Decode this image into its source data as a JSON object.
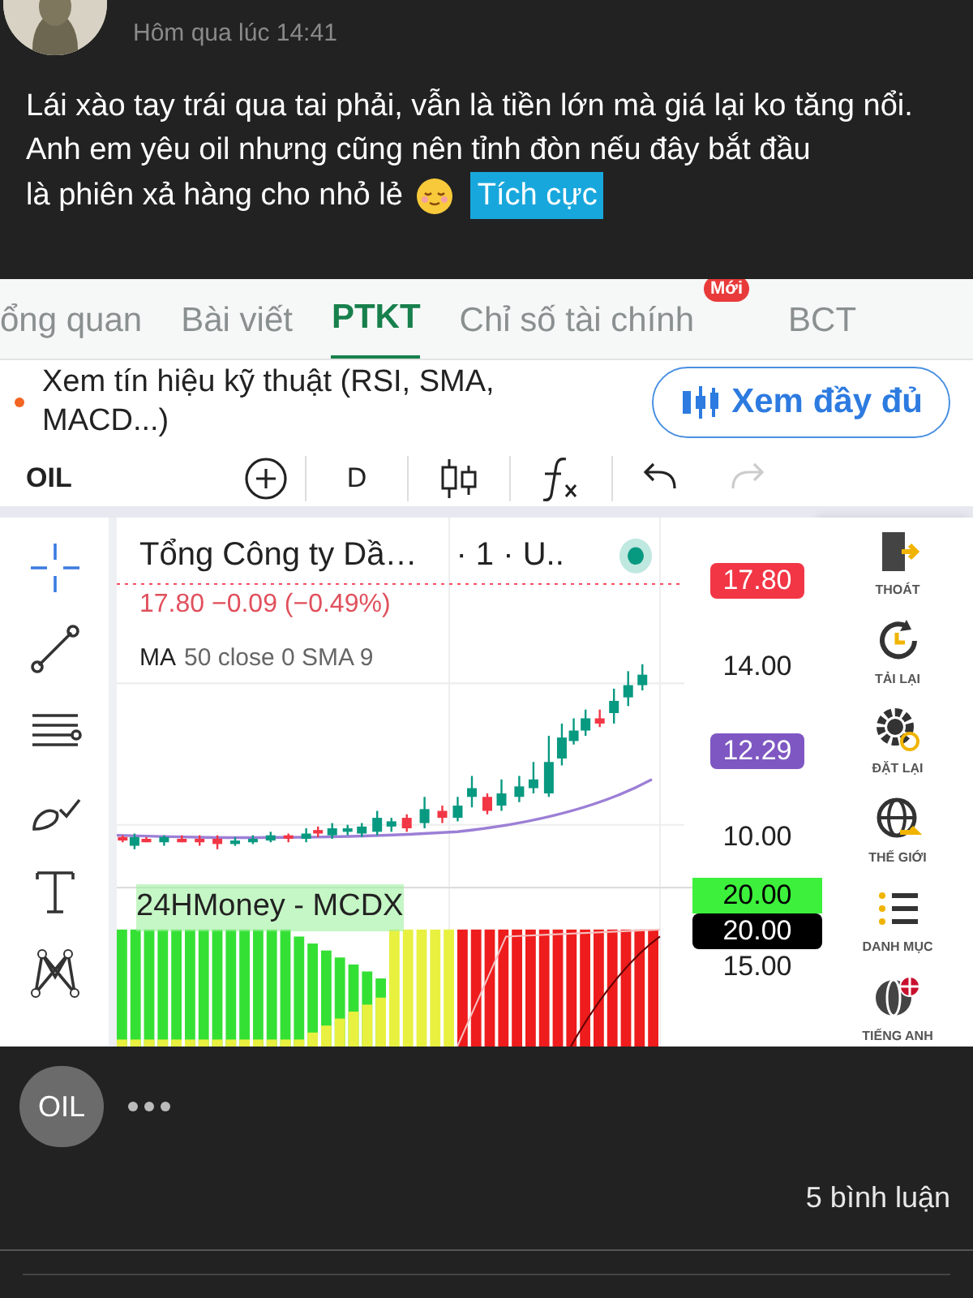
{
  "post": {
    "time": "Hôm qua lúc 14:41",
    "text_lines": [
      "Lái xào tay trái qua tai phải, vẫn là tiền lớn mà giá lại ko tăng nổi.",
      "Anh em yêu oil nhưng cũng nên tỉnh đòn nếu đây bắt đầu",
      "là phiên xả hàng cho nhỏ lẻ"
    ],
    "sentiment_tag": "Tích cực"
  },
  "screenshot": {
    "tabs": [
      {
        "label": "ổng quan",
        "selected": false
      },
      {
        "label": "Bài viết",
        "selected": false
      },
      {
        "label": "PTKT",
        "selected": true
      },
      {
        "label": "Chỉ số tài chính",
        "selected": false,
        "badge": "Mới"
      },
      {
        "label": "BCT",
        "selected": false
      }
    ],
    "signal_text": "Xem tín hiệu kỹ thuật (RSI, SMA, MACD...)",
    "full_button": "Xem đầy đủ",
    "toolbar": {
      "symbol": "OIL",
      "interval": "D"
    },
    "chart": {
      "title": "Tổng Công ty Dầ…",
      "suffix": "· 1 · U..",
      "quote": "17.80 −0.09 (−0.49%)",
      "ma_label": "MA",
      "ma_params": "50 close 0 SMA 9",
      "price_labels": [
        {
          "text": "17.80",
          "kind": "last"
        },
        {
          "text": "14.00",
          "kind": "tick"
        },
        {
          "text": "12.29",
          "kind": "ma"
        },
        {
          "text": "10.00",
          "kind": "tick"
        }
      ],
      "indicator_title": "24HMoney - MCDX",
      "indicator_labels": [
        {
          "text": "20.00",
          "kind": "green"
        },
        {
          "text": "20.00",
          "kind": "black"
        },
        {
          "text": "15.00",
          "kind": "tick"
        }
      ]
    },
    "sidebar": [
      "THOÁT",
      "TẢI LẠI",
      "ĐẶT LẠI",
      "THẾ GIỚI",
      "DANH MỤC",
      "TIẾNG ANH"
    ]
  },
  "footer": {
    "tag": "OIL",
    "comments": "5 bình luận"
  }
}
